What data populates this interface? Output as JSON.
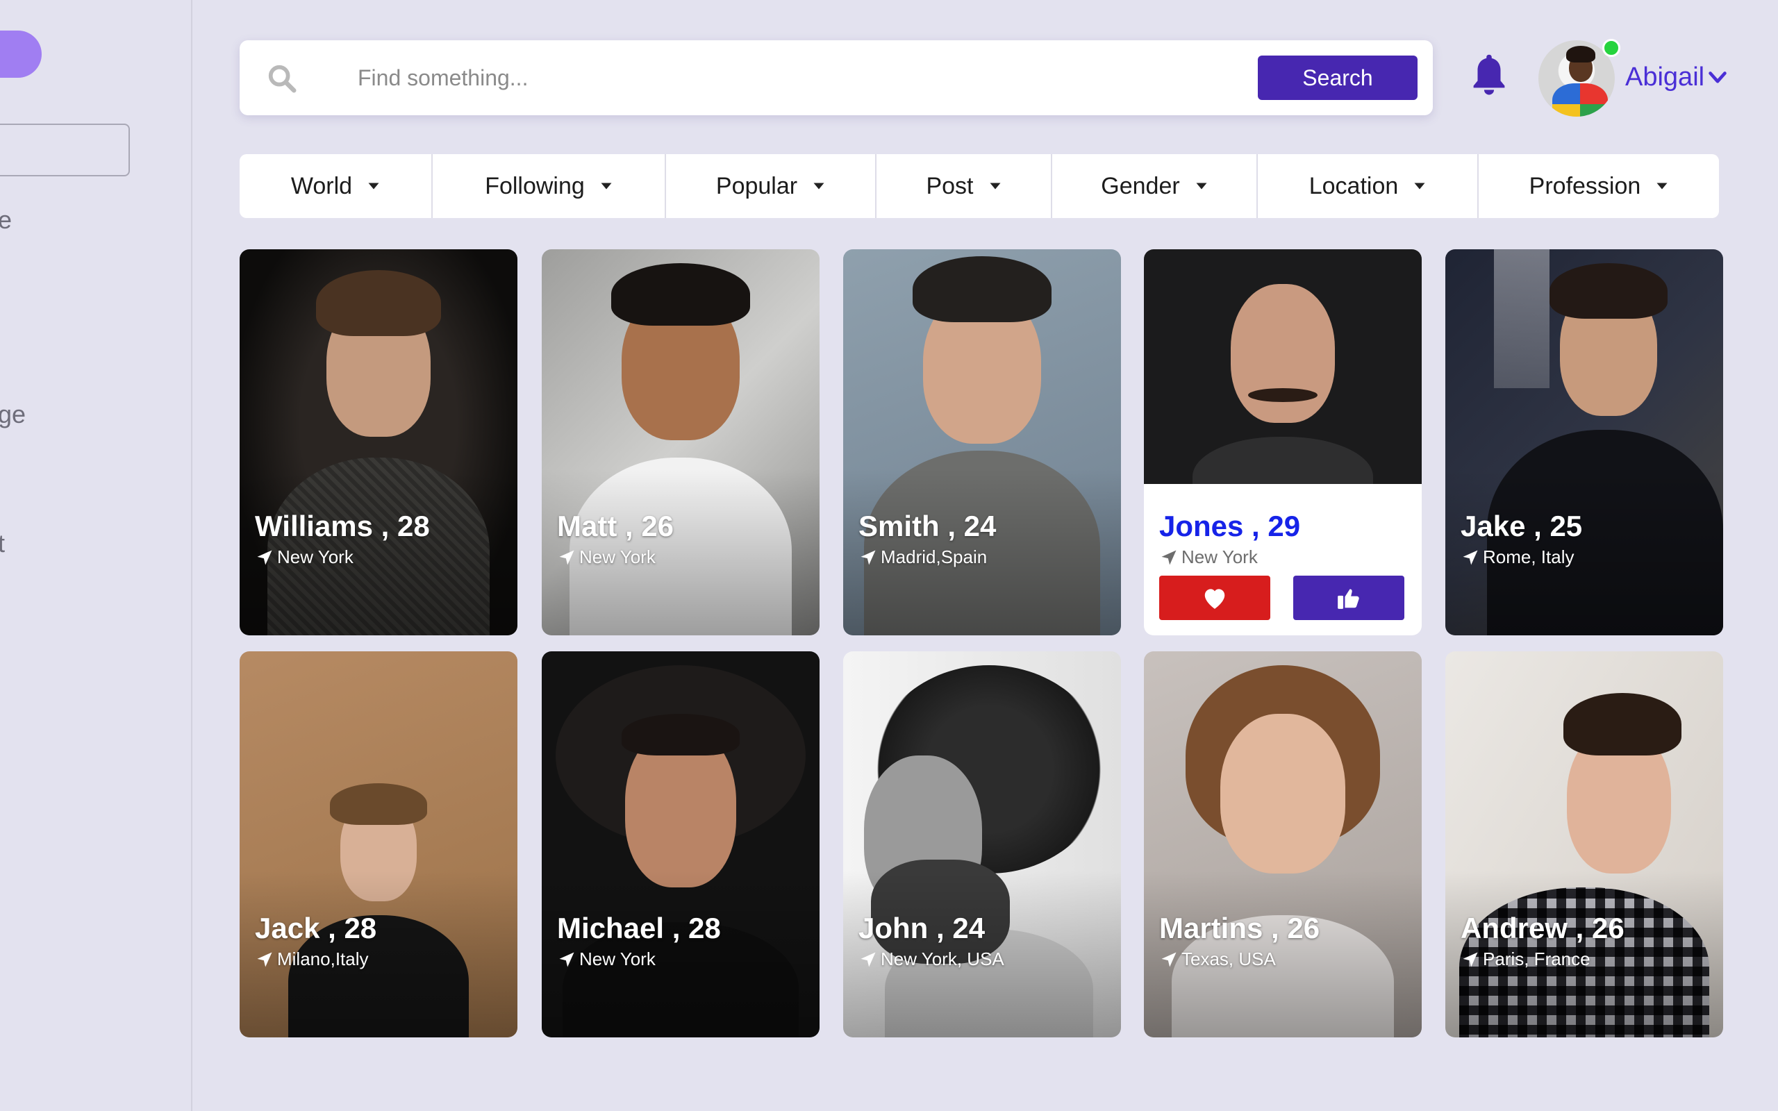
{
  "sidebar": {
    "fragments": [
      "e",
      "ge",
      "t"
    ]
  },
  "search": {
    "placeholder": "Find something...",
    "button_label": "Search"
  },
  "user": {
    "name": "Abigail",
    "online": true
  },
  "filters": [
    {
      "label": "World"
    },
    {
      "label": "Following"
    },
    {
      "label": "Popular"
    },
    {
      "label": "Post"
    },
    {
      "label": "Gender"
    },
    {
      "label": "Location"
    },
    {
      "label": "Profession"
    }
  ],
  "profiles": [
    {
      "name": "Williams , 28",
      "location": "New York"
    },
    {
      "name": "Matt , 26",
      "location": "New York"
    },
    {
      "name": "Smith , 24",
      "location": "Madrid,Spain"
    },
    {
      "name": "Jones , 29",
      "location": "New York"
    },
    {
      "name": "Jake , 25",
      "location": "Rome, Italy"
    },
    {
      "name": "Jack , 28",
      "location": "Milano,Italy"
    },
    {
      "name": "Michael , 28",
      "location": "New York"
    },
    {
      "name": "John , 24",
      "location": "New York, USA"
    },
    {
      "name": "Martins , 26",
      "location": "Texas, USA"
    },
    {
      "name": "Andrew , 26",
      "location": "Paris, France"
    }
  ],
  "colors": {
    "accent": "#4727b0",
    "like": "#d71d1d",
    "highlight_name": "#1623e8",
    "online": "#26d33e",
    "background": "#e3e2ef"
  }
}
